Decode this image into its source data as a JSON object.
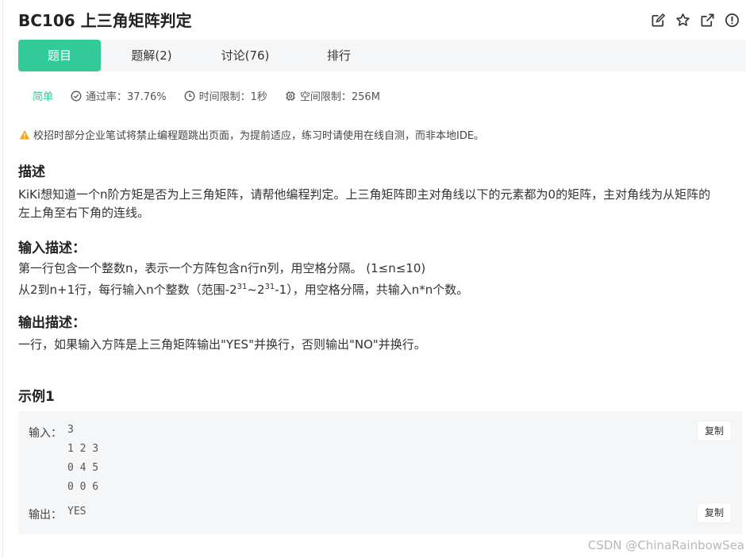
{
  "header": {
    "title": "BC106  上三角矩阵判定",
    "icons": [
      "edit-icon",
      "star-icon",
      "external-link-icon",
      "info-icon"
    ]
  },
  "tabs": [
    {
      "label": "题目",
      "active": true
    },
    {
      "label": "题解(2)",
      "active": false
    },
    {
      "label": "讨论(76)",
      "active": false
    },
    {
      "label": "排行",
      "active": false
    }
  ],
  "meta": {
    "difficulty": "简单",
    "pass_rate": "通过率：37.76%",
    "time_limit": "时间限制：1秒",
    "memory_limit": "空间限制：256M"
  },
  "notice": "校招时部分企业笔试将禁止编程题跳出页面，为提前适应，练习时请使用在线自测，而非本地IDE。",
  "description": {
    "heading": "描述",
    "line1": "KiKi想知道一个n阶方矩是否为上三角矩阵，请帮他编程判定。上三角矩阵即主对角线以下的元素都为0的矩阵，主对角线为从矩阵的",
    "line2": "左上角至右下角的连线。"
  },
  "input_desc": {
    "heading": "输入描述：",
    "line1": "第一行包含一个整数n，表示一个方阵包含n行n列，用空格分隔。 (1≤n≤10)",
    "line2_prefix": "从2到n+1行，每行输入n个整数（范围-2",
    "exp1": "31",
    "line2_mid": "~2",
    "exp2": "31",
    "line2_suffix": "-1），用空格分隔，共输入n*n个数。"
  },
  "output_desc": {
    "heading": "输出描述：",
    "line1": "一行，如果输入方阵是上三角矩阵输出\"YES\"并换行，否则输出\"NO\"并换行。"
  },
  "example": {
    "heading": "示例1",
    "input_label": "输入：",
    "input_code": "3\n1 2 3\n0 4 5\n0 0 6",
    "output_label": "输出：",
    "output_code": "YES",
    "copy_label": "复制"
  },
  "watermark": "CSDN @ChinaRainbowSea",
  "colors": {
    "accent": "#32ca99",
    "tabbar_bg": "#f5f6f7",
    "warning": "#f5a623"
  }
}
